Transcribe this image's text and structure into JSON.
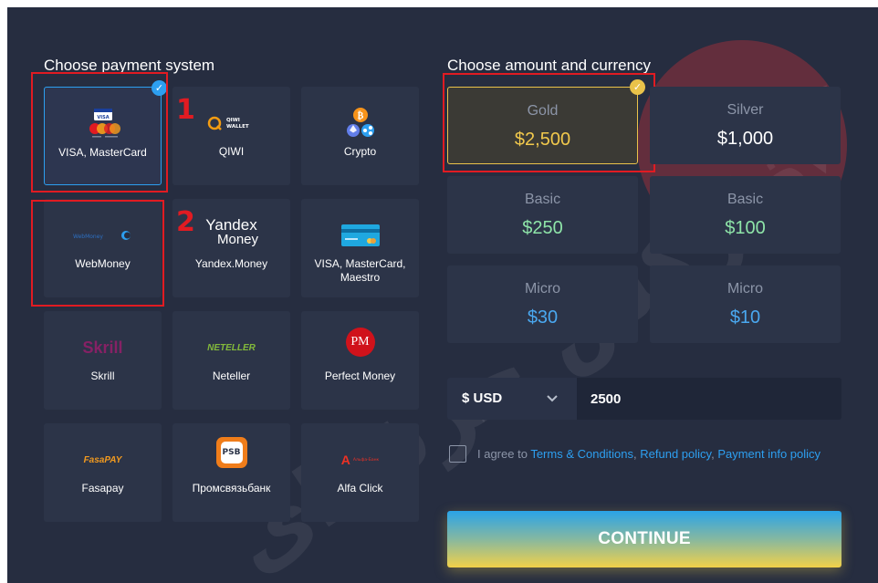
{
  "payment": {
    "title": "Choose payment system",
    "methods": [
      {
        "label": "VISA, MasterCard"
      },
      {
        "label": "QIWI"
      },
      {
        "label": "Crypto"
      },
      {
        "label": "WebMoney"
      },
      {
        "label": "Yandex.Money"
      },
      {
        "label": "VISA, MasterCard, Maestro"
      },
      {
        "label": "Skrill"
      },
      {
        "label": "Neteller"
      },
      {
        "label": "Perfect Money"
      },
      {
        "label": "Fasapay"
      },
      {
        "label": "Промсвязьбанк"
      },
      {
        "label": "Alfa Click"
      }
    ],
    "selected": "VISA, MasterCard"
  },
  "logos": {
    "qiwi_line1": "QIWI",
    "qiwi_line2": "WALLET",
    "webmoney": "WebMoney",
    "yandex_line1": "Yandex",
    "yandex_line2": "Money",
    "skrill": "Skrill",
    "neteller": "NETELLER",
    "pm": "PM",
    "fasapay": "FasaPAY",
    "alfa": "Альфа-Банк",
    "visa": "VISA",
    "psb": "PSB"
  },
  "annotations": {
    "marker1": "1",
    "marker2": "2"
  },
  "amount": {
    "title": "Choose amount and currency",
    "options": [
      {
        "tier": "Gold",
        "value": "$2,500"
      },
      {
        "tier": "Silver",
        "value": "$1,000"
      },
      {
        "tier": "Basic",
        "value": "$250"
      },
      {
        "tier": "Basic",
        "value": "$100"
      },
      {
        "tier": "Micro",
        "value": "$30"
      },
      {
        "tier": "Micro",
        "value": "$10"
      }
    ],
    "selected": "Gold"
  },
  "currency": {
    "selected": "$ USD",
    "amount_value": "2500"
  },
  "agreement": {
    "prefix": "I agree to ",
    "terms_link": "Terms & Conditions",
    "sep1": ", ",
    "refund_link": "Refund policy",
    "sep2": ", ",
    "payment_link": "Payment info policy"
  },
  "continue_label": "CONTINUE",
  "colors": {
    "background": "#262d40",
    "tile": "#2c3448",
    "accent_blue": "#2d9ff0",
    "gold_border": "#e9c24a",
    "annotation_red": "#e11b22",
    "value_yellow": "#f2c94c",
    "value_white": "#ffffff",
    "value_green": "#8ee4a8",
    "value_blue": "#4aa8f0"
  }
}
